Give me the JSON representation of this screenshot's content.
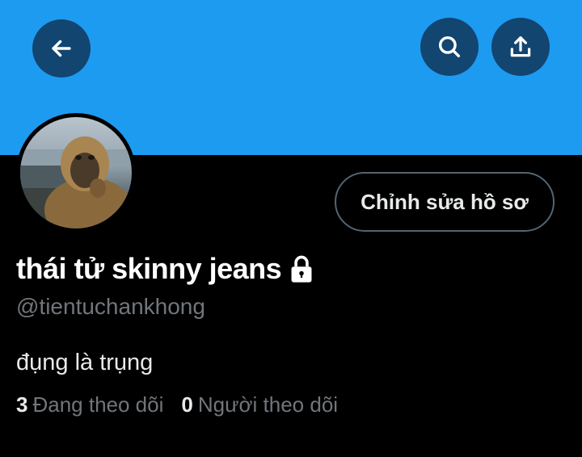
{
  "colors": {
    "accent": "#1d9bf0",
    "background": "#000000",
    "muted": "#71767b"
  },
  "header": {
    "back_icon": "arrow-left-icon",
    "search_icon": "search-icon",
    "share_icon": "share-upload-icon"
  },
  "profile": {
    "edit_button_label": "Chỉnh sửa hồ sơ",
    "display_name": "thái tử skinny jeans",
    "protected_icon": "lock-icon",
    "handle": "@tientuchankhong",
    "bio": "đụng là trụng",
    "following": {
      "count": "3",
      "label": "Đang theo dõi"
    },
    "followers": {
      "count": "0",
      "label": "Người theo dõi"
    }
  }
}
